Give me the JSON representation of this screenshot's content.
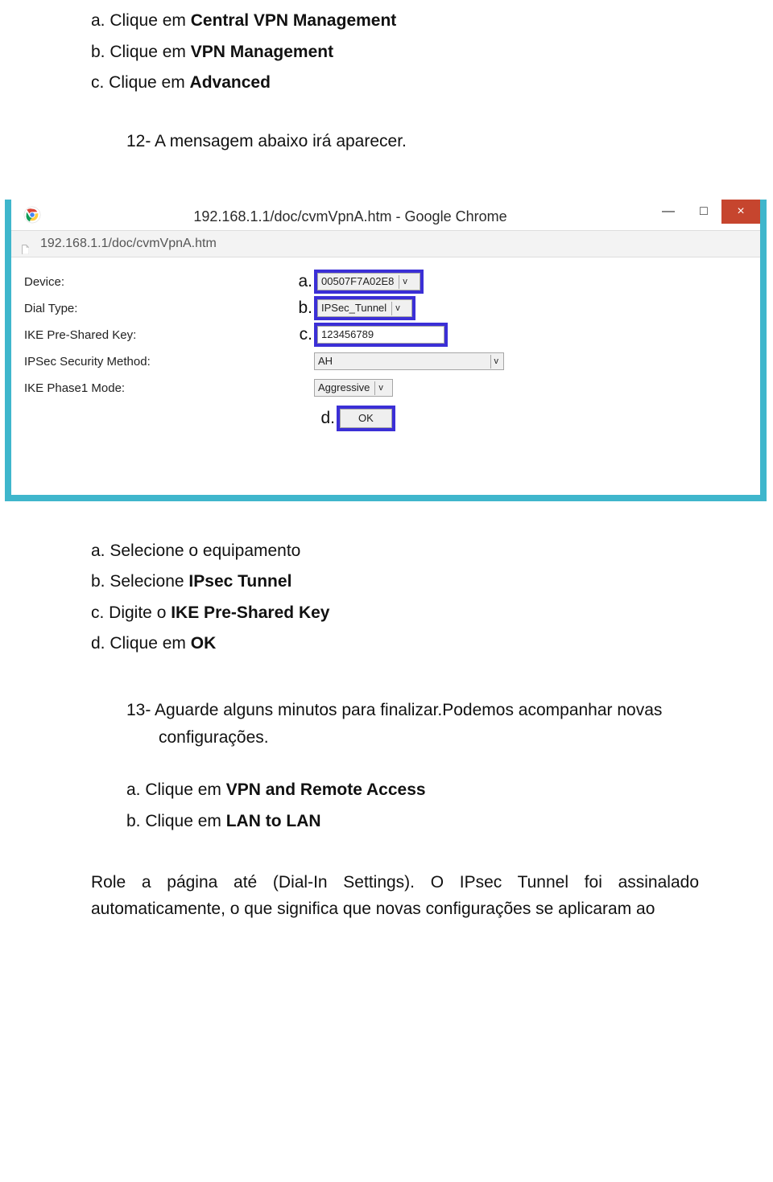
{
  "step11": {
    "a_prefix": "a. Clique em ",
    "a_bold": "Central VPN Management",
    "b_prefix": "b. Clique em ",
    "b_bold": "VPN Management",
    "c_prefix": "c. Clique em ",
    "c_bold": "Advanced"
  },
  "step12_text": "12- A mensagem abaixo irá aparecer.",
  "browser": {
    "title": "192.168.1.1/doc/cvmVpnA.htm - Google Chrome",
    "minimize": "—",
    "maximize": "□",
    "close": "×",
    "url": "192.168.1.1/doc/cvmVpnA.htm",
    "labels": {
      "device": "Device:",
      "dial_type": "Dial Type:",
      "ike_key": "IKE Pre-Shared Key:",
      "ipsec_method": "IPSec Security Method:",
      "ike_mode": "IKE Phase1 Mode:"
    },
    "callouts": {
      "a": "a.",
      "b": "b.",
      "c": "c.",
      "d": "d."
    },
    "values": {
      "device": "00507F7A02E8",
      "dial_type": "IPSec_Tunnel",
      "ike_key": "123456789",
      "ipsec_method": "AH",
      "ike_mode": "Aggressive",
      "ok": "OK"
    },
    "caret": "v"
  },
  "after": {
    "a": "a. Selecione o equipamento",
    "b_prefix": "b. Selecione ",
    "b_bold": "IPsec Tunnel",
    "c_prefix": "c. Digite o ",
    "c_bold": "IKE Pre-Shared Key",
    "d_prefix": "d. Clique em ",
    "d_bold": "OK"
  },
  "step13": {
    "line1": "13- Aguarde alguns minutos para finalizar.Podemos acompanhar novas",
    "line2": "configurações."
  },
  "sublist13": {
    "a_prefix": "a. Clique em ",
    "a_bold": "VPN and Remote Access",
    "b_prefix": "b. Clique em ",
    "b_bold": "LAN to LAN"
  },
  "para": "Role a página até (Dial-In Settings). O IPsec Tunnel foi assinalado automaticamente, o que significa que novas configurações se aplicaram ao"
}
